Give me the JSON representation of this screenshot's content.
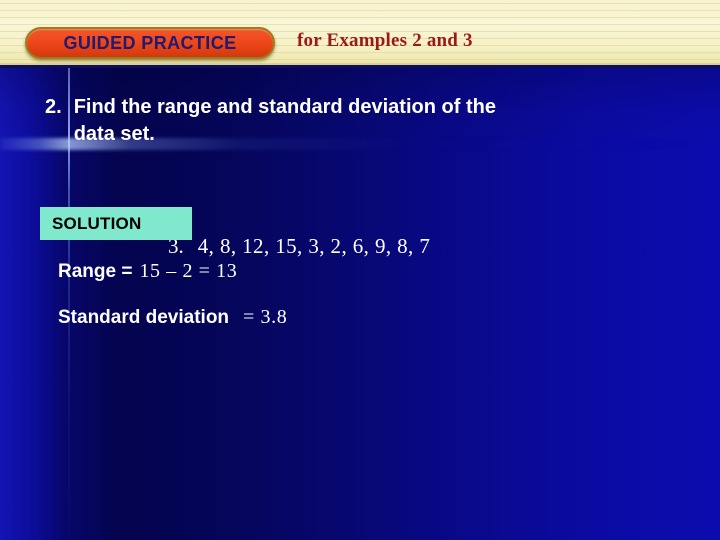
{
  "header": {
    "badge_label": "GUIDED PRACTICE",
    "subtitle": "for Examples 2 and 3",
    "badge_fill_color": "#EF4A1E",
    "badge_border_color": "#9A7D1C",
    "badge_text_color": "#221A6E",
    "subtitle_color": "#9C1A16",
    "band_color": "#F7F3CF"
  },
  "slide": {
    "background_color": "#04044F",
    "accent_line_color": "#A5BEFF"
  },
  "question": {
    "number": "2.",
    "text": "Find the range and standard deviation of the data set."
  },
  "dataset": {
    "number": "3.",
    "values": "4, 8, 12, 15, 3, 2, 6, 9, 8, 7"
  },
  "solution": {
    "heading": "SOLUTION",
    "heading_background_color": "#7FE8CD",
    "heading_text_color": "#000000",
    "range": {
      "label": "Range =",
      "expression": "15 – 2 = 13"
    },
    "standard_deviation": {
      "label": "Standard deviation",
      "expression": "= 3.8"
    }
  }
}
